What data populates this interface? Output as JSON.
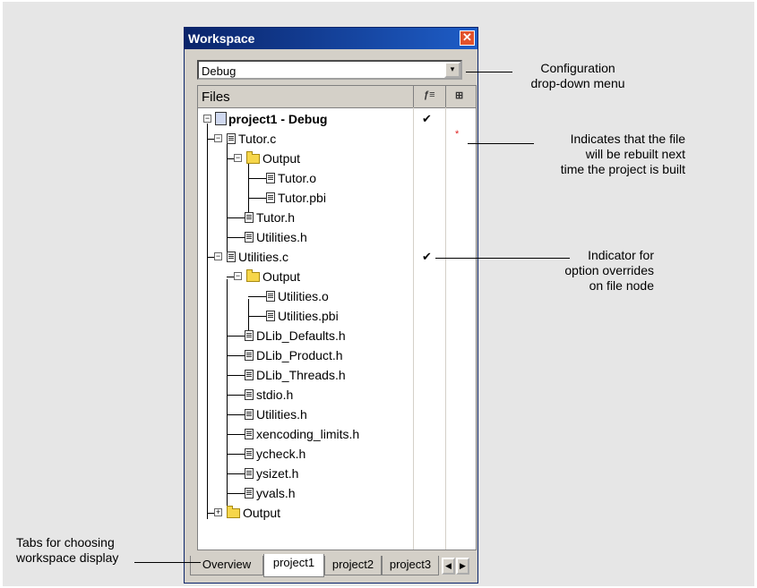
{
  "window": {
    "title": "Workspace",
    "close_label": "✕"
  },
  "config": {
    "selected": "Debug",
    "dropdown_arrow": "▾"
  },
  "tree_header": {
    "files_label": "Files",
    "col1_icon": "overrides-icon",
    "col2_icon": "rebuild-icon"
  },
  "tree": {
    "project": {
      "name": "project1 - Debug",
      "check": "✔"
    },
    "items": [
      {
        "label": "Tutor.c",
        "rebuild": "*"
      },
      {
        "label": "Output"
      },
      {
        "label": "Tutor.o"
      },
      {
        "label": "Tutor.pbi"
      },
      {
        "label": "Tutor.h"
      },
      {
        "label": "Utilities.h"
      },
      {
        "label": "Utilities.c",
        "check": "✔"
      },
      {
        "label": "Output"
      },
      {
        "label": "Utilities.o"
      },
      {
        "label": "Utilities.pbi"
      },
      {
        "label": "DLib_Defaults.h"
      },
      {
        "label": "DLib_Product.h"
      },
      {
        "label": "DLib_Threads.h"
      },
      {
        "label": "stdio.h"
      },
      {
        "label": "Utilities.h"
      },
      {
        "label": "xencoding_limits.h"
      },
      {
        "label": "ycheck.h"
      },
      {
        "label": "ysizet.h"
      },
      {
        "label": "yvals.h"
      },
      {
        "label": "Output"
      }
    ]
  },
  "tabs": [
    {
      "label": "Overview",
      "active": false
    },
    {
      "label": "project1",
      "active": true
    },
    {
      "label": "project2",
      "active": false
    },
    {
      "label": "project3",
      "active": false
    }
  ],
  "tab_arrows": {
    "left": "◀",
    "right": "▶"
  },
  "callouts": {
    "config_line1": "Configuration",
    "config_line2": "drop-down menu",
    "rebuild_line1": "Indicates that the file",
    "rebuild_line2": "will be rebuilt next",
    "rebuild_line3": "time the project is built",
    "override_line1": "Indicator for",
    "override_line2": "option overrides",
    "override_line3": "on file node",
    "tabs_line1": "Tabs for choosing",
    "tabs_line2": "workspace display"
  },
  "colors": {
    "titlebar": "#0a246a",
    "close": "#e2522b",
    "folder": "#f6d64a",
    "rebuild_marker": "#e02020"
  }
}
